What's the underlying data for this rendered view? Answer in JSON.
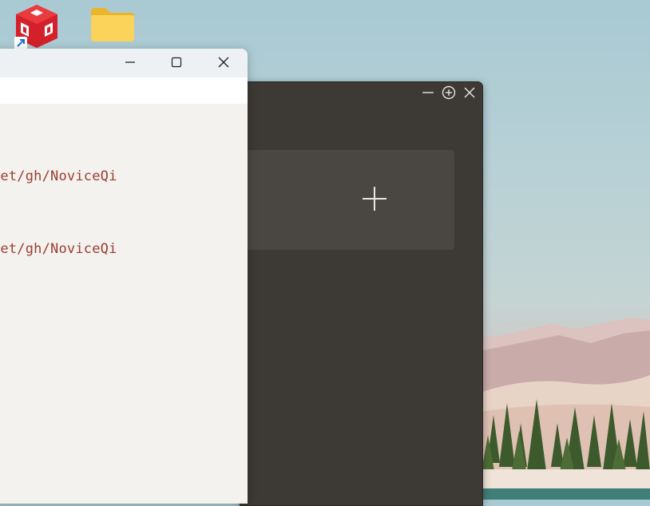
{
  "desktop": {
    "icons": [
      {
        "name": "app-shortcut-icon",
        "shortcut": true
      },
      {
        "name": "folder-icon"
      }
    ]
  },
  "editor_window": {
    "code_lines": [
      "net/gh/NoviceQi",
      "net/gh/NoviceQi"
    ],
    "controls": [
      "minimize-icon",
      "maximize-icon",
      "close-icon"
    ]
  },
  "dark_window": {
    "controls": [
      "minimize-icon",
      "zoom-in-icon",
      "close-icon"
    ],
    "add_card_icon": "plus-icon"
  },
  "colors": {
    "code_text": "#9b3d33",
    "dark_window_bg": "#3d3934",
    "add_card_bg": "#4a4743",
    "editor_bg": "#f3f2ee",
    "titlebar_bg": "#edf1f4"
  }
}
